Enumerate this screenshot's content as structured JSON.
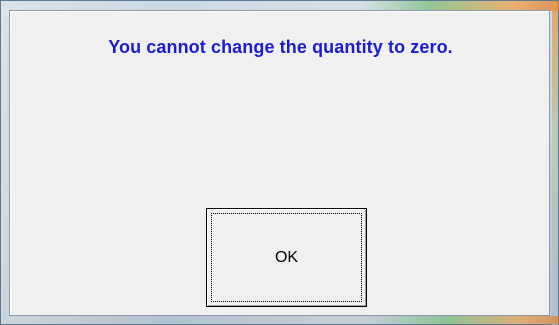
{
  "dialog": {
    "message": "You cannot change the quantity to zero.",
    "ok_label": "OK"
  },
  "colors": {
    "message_text": "#1c1cd0",
    "client_background": "#f0f0f0",
    "button_border": "#000000"
  }
}
